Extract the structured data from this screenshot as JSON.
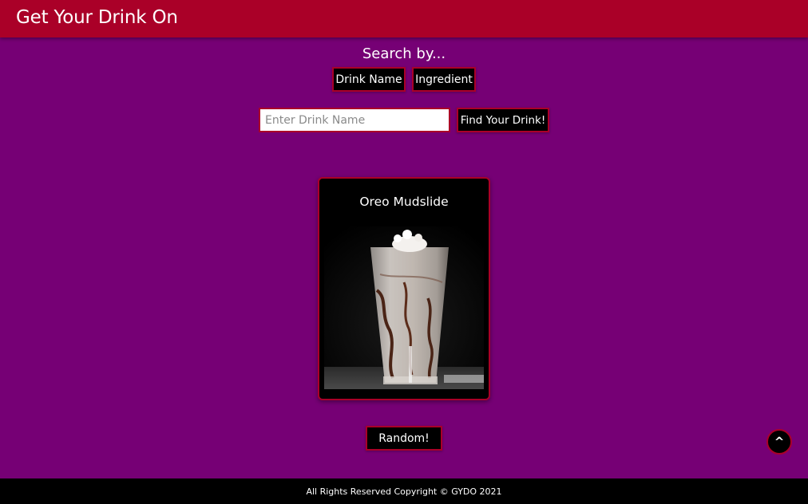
{
  "header": {
    "title": "Get Your Drink On"
  },
  "search": {
    "heading": "Search by...",
    "mode_buttons": [
      "Drink Name",
      "Ingredient"
    ],
    "input_placeholder": "Enter Drink Name",
    "input_value": "",
    "submit_label": "Find Your Drink!"
  },
  "drink_card": {
    "name": "Oreo Mudslide",
    "image_icon": "drink-photo"
  },
  "random_button": {
    "label": "Random!"
  },
  "back_to_top": {
    "label": "^"
  },
  "footer": {
    "text": "All Rights Reserved Copyright © GYDO 2021"
  },
  "colors": {
    "background": "#760075",
    "header": "#aa0028",
    "accent_border": "#aa0028",
    "button_bg": "#000000",
    "footer": "#000000"
  }
}
